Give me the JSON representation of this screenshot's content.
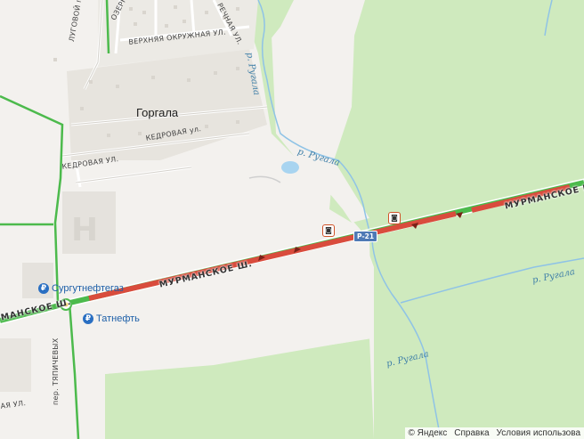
{
  "map": {
    "settlement": "Горгала",
    "streets": {
      "lugovoy": "ЛУГОВОЙ пер.",
      "ozernaya": "ОЗЕРНАЯ ул.",
      "verkhnyaya_okruzhnaya": "ВЕРХНЯЯ ОКРУЖНАЯ УЛ.",
      "rechnaya": "РЕЧНАЯ УЛ.",
      "kedrovaya_upper": "КЕДРОВАЯ ул.",
      "kedrovaya_lower": "КЕДРОВАЯ УЛ.",
      "tyapichevykh": "пер. ТЯПИЧЕВЫХ",
      "edge": "АЯ УЛ."
    },
    "highway": {
      "name_right": "МУРМАНСКОЕ Ш.",
      "name_center": "МУРМАНСКОЕ Ш.",
      "name_left": "МАНСКОЕ Ш.",
      "route_number": "Р-21"
    },
    "rivers": {
      "top": "р. Ругала",
      "middle": "р. Ругала",
      "right": "р. Ругала",
      "bottom": "р. Ругала"
    },
    "pois": {
      "gas1": {
        "icon": "fuel-station-icon",
        "label": "Сургутнефтегаз"
      },
      "gas2": {
        "icon": "fuel-station-icon",
        "label": "Татнефть"
      }
    },
    "colors": {
      "forest": "#cfeabe",
      "traffic_jam": "#d94c3d",
      "traffic_free": "#4cba4c",
      "water": "#a8d4f0"
    }
  },
  "footer": {
    "copyright": "© Яндекс",
    "help": "Справка",
    "terms": "Условия использова"
  }
}
